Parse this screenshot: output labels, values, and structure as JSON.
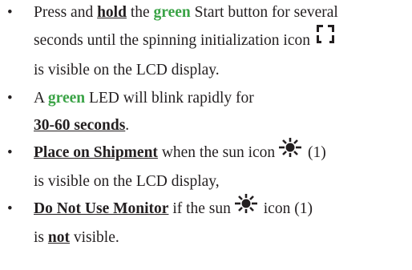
{
  "colors": {
    "text": "#231f20",
    "accent_green": "#3aa346"
  },
  "icons": {
    "spinner": "spinning-initialization-icon",
    "sun": "sun-icon"
  },
  "items": [
    {
      "t1": "Press and ",
      "t2": "hold",
      "t3": " the ",
      "t4": "green",
      "t5": " Start button for several",
      "t6": "seconds until the spinning initialization icon",
      "t7": "is visible on the LCD display."
    },
    {
      "t1": "A ",
      "t2": "green",
      "t3": " LED will blink rapidly for",
      "t4": "30-60 seconds",
      "t5": "."
    },
    {
      "t1": "Place on Shipment",
      "t2": " when the sun icon",
      "t3": " (1)",
      "t4": "is visible on the LCD display,"
    },
    {
      "t1": "Do Not Use Monitor",
      "t2": " if the sun",
      "t3": " icon (1)",
      "t4": "is ",
      "t5": "not",
      "t6": " visible."
    }
  ]
}
